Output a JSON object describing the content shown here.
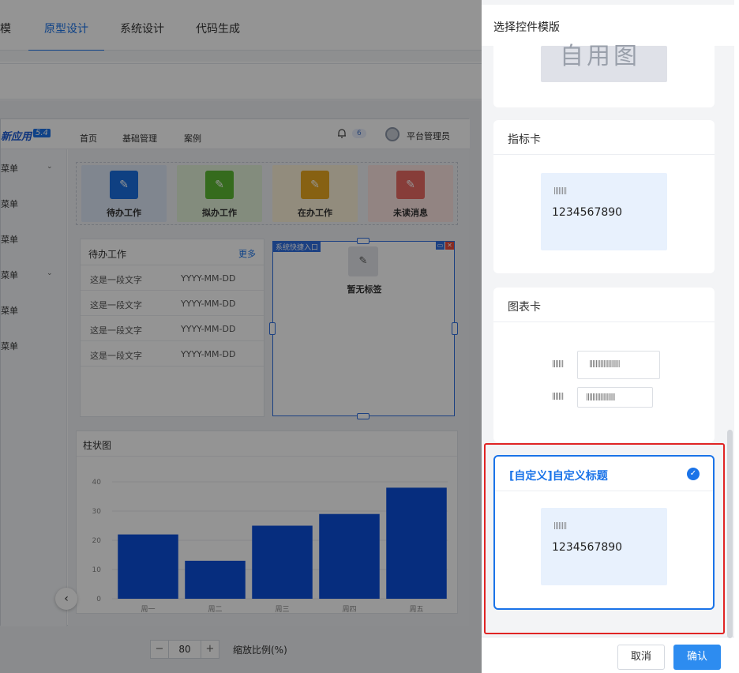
{
  "topnav": {
    "tabs": [
      "模",
      "原型设计",
      "系统设计",
      "代码生成"
    ],
    "active_index": 1
  },
  "mini_app": {
    "logo": "新应用",
    "version": "5.4",
    "nav": [
      "首页",
      "基础管理",
      "案例"
    ],
    "badge": "6",
    "user": "平台管理员",
    "sidebar": [
      {
        "label": "菜单",
        "chevron": true
      },
      {
        "label": "菜单",
        "chevron": false
      },
      {
        "label": "菜单",
        "chevron": false
      },
      {
        "label": "菜单",
        "chevron": true
      },
      {
        "label": "菜单",
        "chevron": false
      },
      {
        "label": "菜单",
        "chevron": false
      }
    ],
    "tiles": [
      {
        "label": "待办工作",
        "bg": "#dce7f7",
        "icon_bg": "#1a6fe0"
      },
      {
        "label": "拟办工作",
        "bg": "#e2f2d8",
        "icon_bg": "#5cb832"
      },
      {
        "label": "在办工作",
        "bg": "#fbf1d8",
        "icon_bg": "#e9a81f"
      },
      {
        "label": "未读消息",
        "bg": "#fbe3e1",
        "icon_bg": "#e96a63"
      }
    ],
    "todo": {
      "title": "待办工作",
      "more": "更多",
      "rows": [
        {
          "text": "这是一段文字",
          "date": "YYYY-MM-DD"
        },
        {
          "text": "这是一段文字",
          "date": "YYYY-MM-DD"
        },
        {
          "text": "这是一段文字",
          "date": "YYYY-MM-DD"
        },
        {
          "text": "这是一段文字",
          "date": "YYYY-MM-DD"
        }
      ]
    },
    "quick": {
      "tag": "系统快捷入口",
      "empty": "暂无标签"
    },
    "chart_title": "柱状图",
    "zoom": {
      "value": "80",
      "label": "缩放比例(%)",
      "minus": "−",
      "plus": "+"
    }
  },
  "chart_data": {
    "type": "bar",
    "title": "柱状图",
    "categories": [
      "周一",
      "周二",
      "周三",
      "周四",
      "周五"
    ],
    "values": [
      22,
      13,
      25,
      29,
      38
    ],
    "yticks": [
      0,
      10,
      20,
      30,
      40
    ],
    "ylim": [
      0,
      40
    ],
    "color": "#0b4fd9",
    "grid": true
  },
  "drawer": {
    "title": "选择控件模版",
    "cards": [
      {
        "title": "指标卡",
        "preview_label": "||||||||",
        "preview_value": "1234567890"
      },
      {
        "title": "图表卡",
        "rows": [
          {
            "label": "|||||||",
            "box": "|||||||||||||||||||"
          },
          {
            "label": "|||||||",
            "box": "||||||||||||||||||"
          }
        ]
      },
      {
        "title": "[自定义]自定义标题",
        "preview_label": "||||||||",
        "preview_value": "1234567890",
        "selected": true
      }
    ],
    "top_partial_text": "自用图",
    "cancel": "取消",
    "confirm": "确认",
    "check_icon": "✓"
  }
}
